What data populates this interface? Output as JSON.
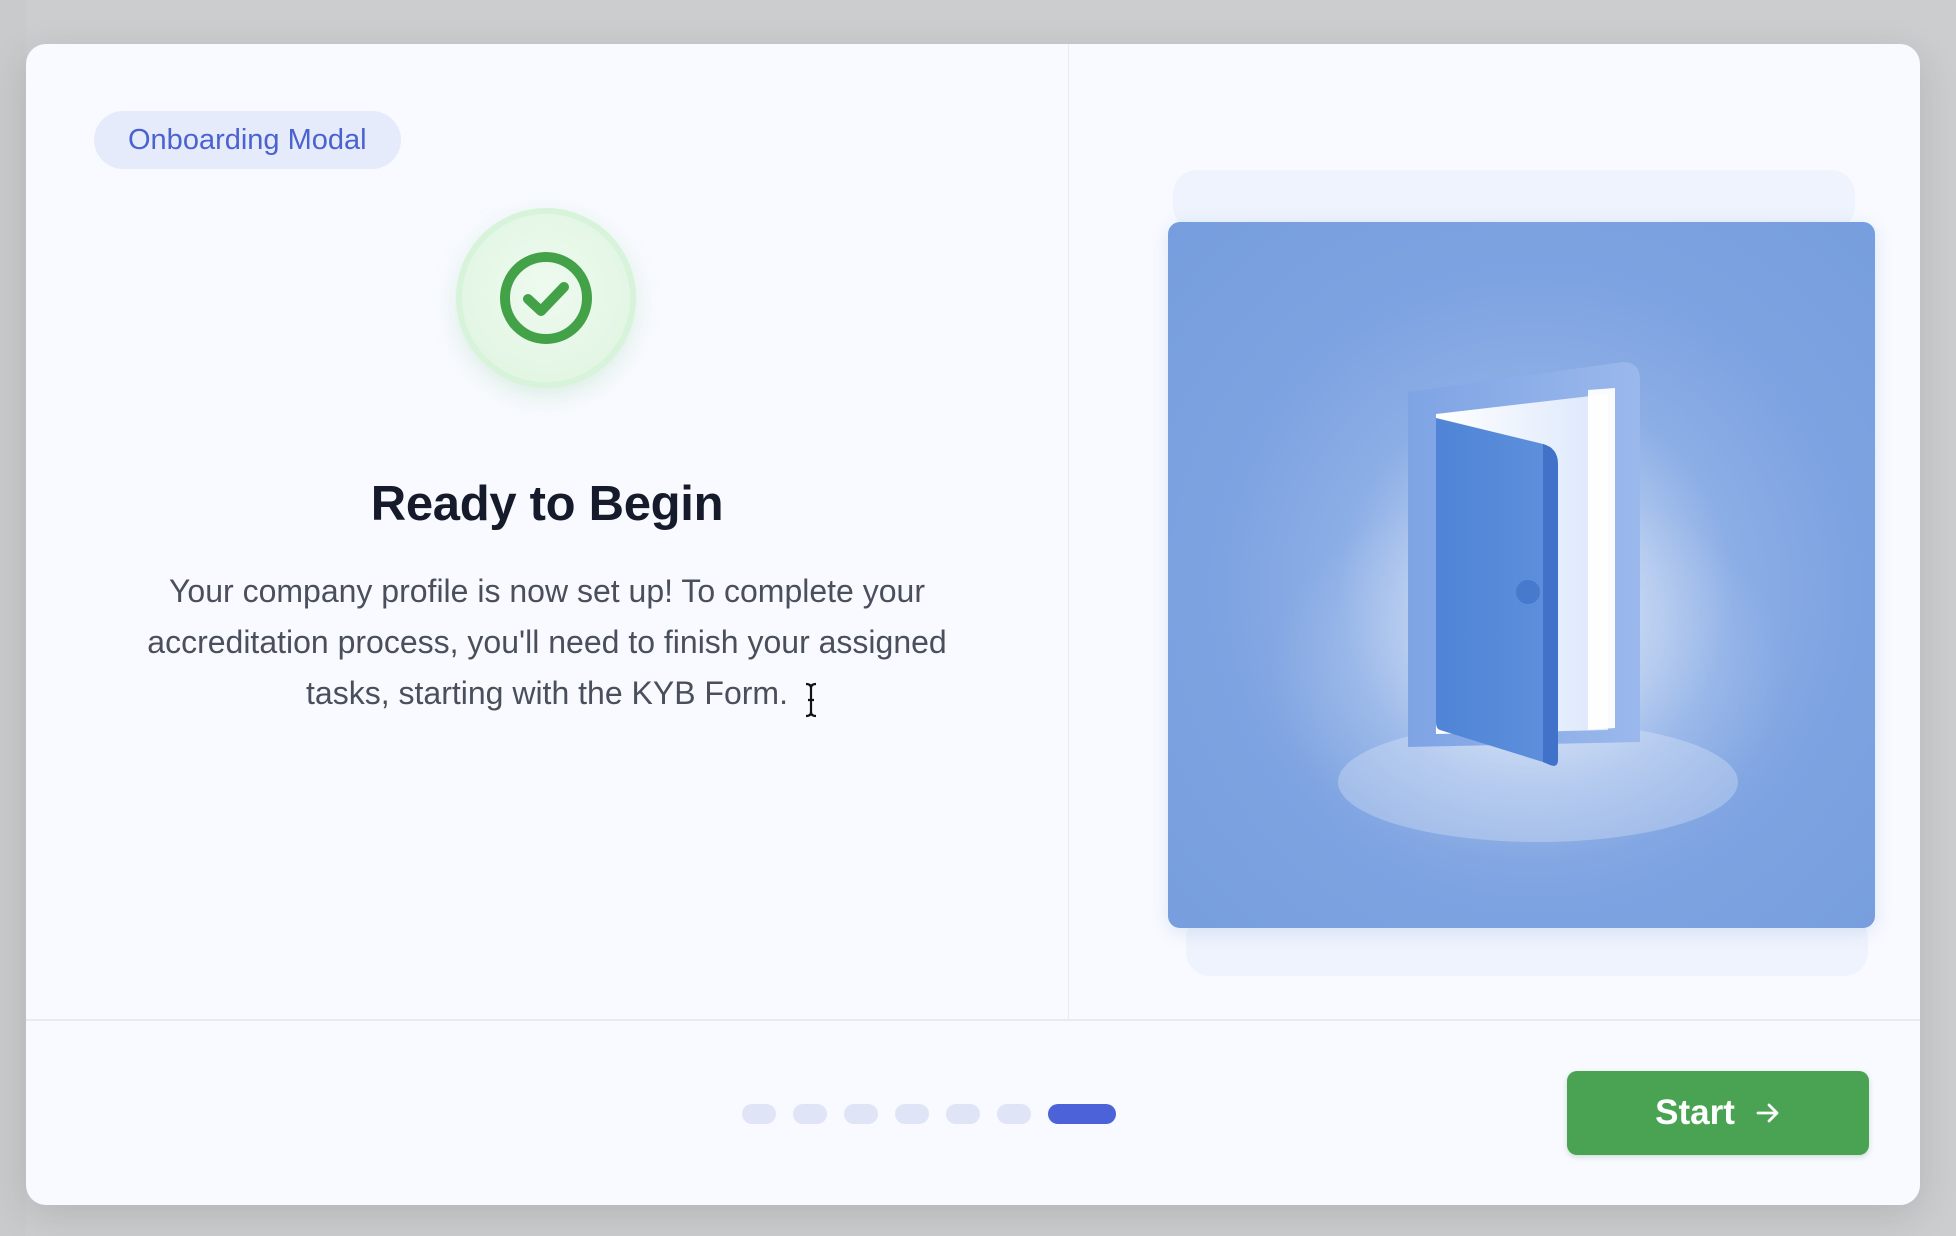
{
  "modal": {
    "tag_label": "Onboarding Modal",
    "title": "Ready to Begin",
    "description": "Your company profile is now set up! To complete your accreditation process, you'll need to finish your assigned tasks, starting with the KYB Form.",
    "status_icon": "check-circle-icon",
    "illustration": "open-door-illustration"
  },
  "pager": {
    "total_steps": 7,
    "current_step": 7
  },
  "footer": {
    "start_label": "Start",
    "start_icon": "arrow-right-icon"
  },
  "colors": {
    "accent": "#4b62d8",
    "tag_bg": "#e6ebfb",
    "success": "#4aa352",
    "check": "#43a148",
    "illustration_bg": "#7ea3e1"
  }
}
